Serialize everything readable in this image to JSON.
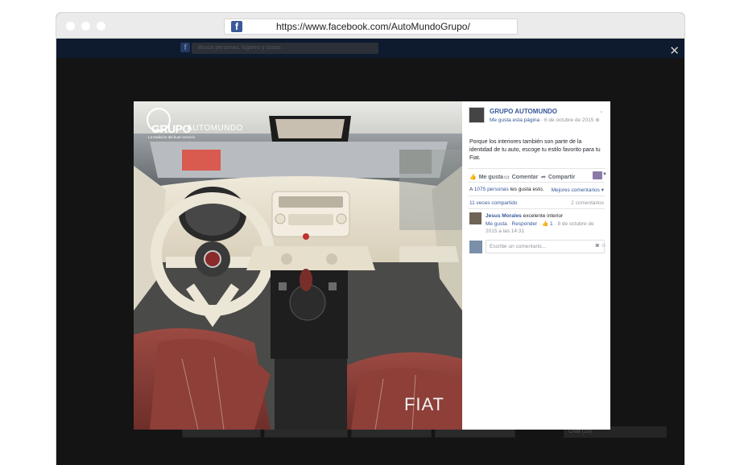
{
  "browser": {
    "url": "https://www.facebook.com/AutoMundoGrupo/",
    "favicon_letter": "f"
  },
  "background_page": {
    "search_placeholder": "Busca personas, lugares y cosas",
    "chat_label": "Chat (29)"
  },
  "photo": {
    "brand_watermark": "FIAT",
    "logo_word1": "GRUPO",
    "logo_word2": "AUTOMUNDO",
    "logo_tagline": "La tradición del buen servicio"
  },
  "post": {
    "page_name": "GRUPO AUTOMUNDO",
    "liked_label": "Me gusta esta página",
    "date": "6 de octubre de 2015",
    "text": "Porque los interiores también son parte de la identidad de tu auto, escoge tu estilo favorito para tu Fiat.",
    "actions": {
      "like": "Me gusta",
      "comment": "Comentar",
      "share": "Compartir"
    },
    "likes_prefix": "A",
    "likes_link": "1075 personas",
    "likes_suffix": "les gusta esto.",
    "best_comments": "Mejores comentarios",
    "shares": "11 veces compartido",
    "comment_count": "2 comentarios",
    "comment": {
      "author": "Jesus Morales",
      "text": "excelente interior",
      "like_label": "Me gusta",
      "reply_label": "Responder",
      "like_count": "1",
      "timestamp": "8 de octubre de 2015 a las 14:31"
    },
    "comment_placeholder": "Escribe un comentario..."
  },
  "colors": {
    "facebook_blue": "#3b5998",
    "link_blue": "#365899",
    "overlay": "#141414"
  }
}
